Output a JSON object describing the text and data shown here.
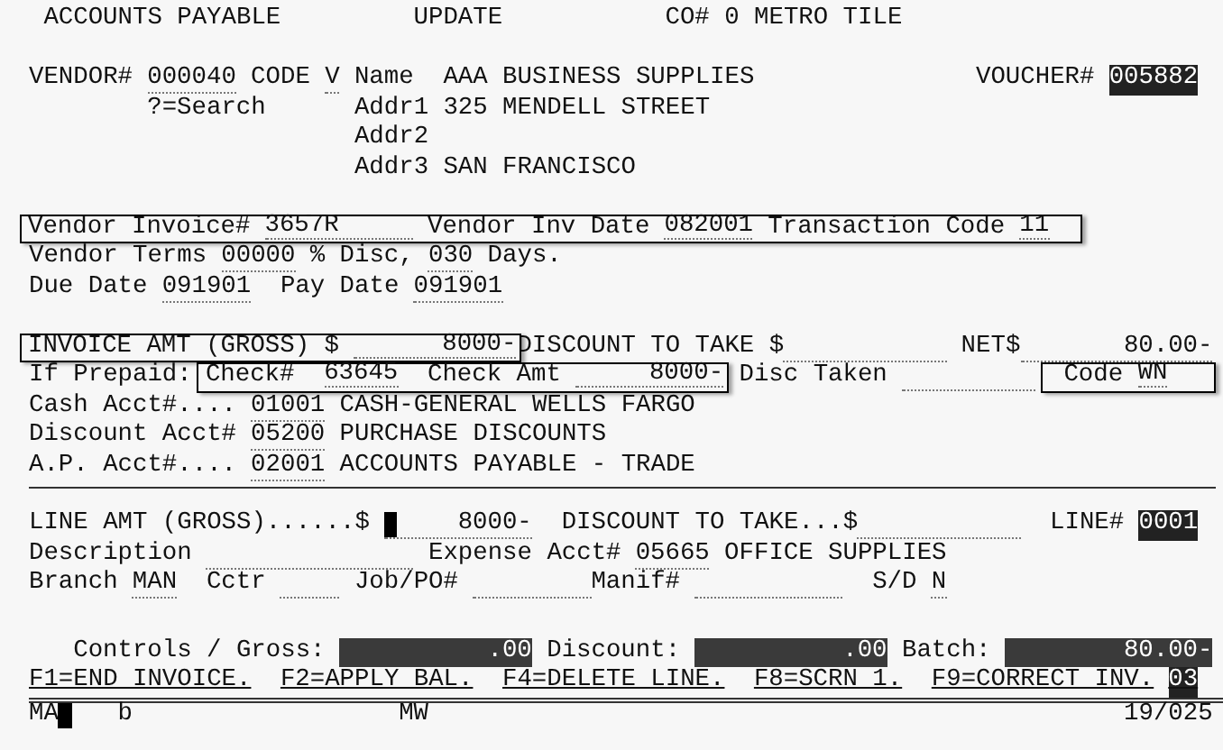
{
  "header": {
    "module": "ACCOUNTS PAYABLE",
    "mode": "UPDATE",
    "company": "CO# 0 METRO TILE"
  },
  "vendor": {
    "label": "VENDOR#",
    "number": "000040",
    "code_label": "CODE",
    "code": "V",
    "search_hint": "?=Search",
    "name_label": "Name",
    "name": "AAA BUSINESS SUPPLIES",
    "address": [
      {
        "label": "Addr1",
        "value": "325 MENDELL STREET"
      },
      {
        "label": "Addr2"
      },
      {
        "label": "Addr3",
        "value": "SAN FRANCISCO"
      }
    ]
  },
  "voucher": {
    "label": "VOUCHER#",
    "value": "005882"
  },
  "invoice": {
    "number_label": "Vendor Invoice#",
    "number": "3657R",
    "date_label": "Vendor Inv Date",
    "date": "082001",
    "transaction_label": "Transaction Code",
    "transaction_code": "11"
  },
  "terms": {
    "label": "Vendor Terms",
    "discount_pct": "00000",
    "discount_label": "% Disc,",
    "days": "030",
    "days_label": "Days."
  },
  "dates": {
    "due_label": "Due Date",
    "due": "091901",
    "pay_label": "Pay Date",
    "pay": "091901"
  },
  "amounts": {
    "gross_label": "INVOICE AMT (GROSS) $",
    "gross": "8000-",
    "discount_label": "DISCOUNT TO TAKE $",
    "net_label": "NET$",
    "net": "80.00-"
  },
  "prepaid": {
    "label": "If Prepaid:",
    "check_label": "Check#",
    "check": "63645",
    "check_amt_label": "Check Amt",
    "check_amt": "8000-",
    "disc_taken_label": "Disc Taken",
    "code_label": "Code",
    "code": "WN"
  },
  "accounts": [
    {
      "label": "Cash Acct#....",
      "number": "01001",
      "name": "CASH-GENERAL WELLS FARGO"
    },
    {
      "label": "Discount Acct#",
      "number": "05200",
      "name": "PURCHASE DISCOUNTS"
    },
    {
      "label": "A.P. Acct#....",
      "number": "02001",
      "name": "ACCOUNTS PAYABLE - TRADE"
    }
  ],
  "line": {
    "amount_label": "LINE AMT (GROSS)......$",
    "amount": "8000-",
    "discount_label": "DISCOUNT TO TAKE...$",
    "line_label": "LINE#",
    "line": "0001",
    "description_label": "Description",
    "expense_label": "Expense Acct#",
    "expense": "05665",
    "expense_name": "OFFICE SUPPLIES",
    "branch_label": "Branch",
    "branch": "MAN",
    "cctr_label": "Cctr",
    "job_label": "Job/PO#",
    "manif_label": "Manif#",
    "sd_label": "S/D",
    "sd": "N"
  },
  "controls": [
    {
      "label": "Controls / Gross:",
      "value": ".00"
    },
    {
      "label": "Discount:",
      "value": ".00"
    },
    {
      "label": "Batch:",
      "value": "80.00-"
    }
  ],
  "function_keys": [
    "F1=END INVOICE.",
    "F2=APPLY BAL.",
    "F4=DELETE LINE.",
    "F8=SCRN 1.",
    "F9=CORRECT INV."
  ],
  "screen_number": "03",
  "status_bar": {
    "field_1": "MA",
    "field_2": "b",
    "field_3": "MW",
    "position": "19/025"
  }
}
